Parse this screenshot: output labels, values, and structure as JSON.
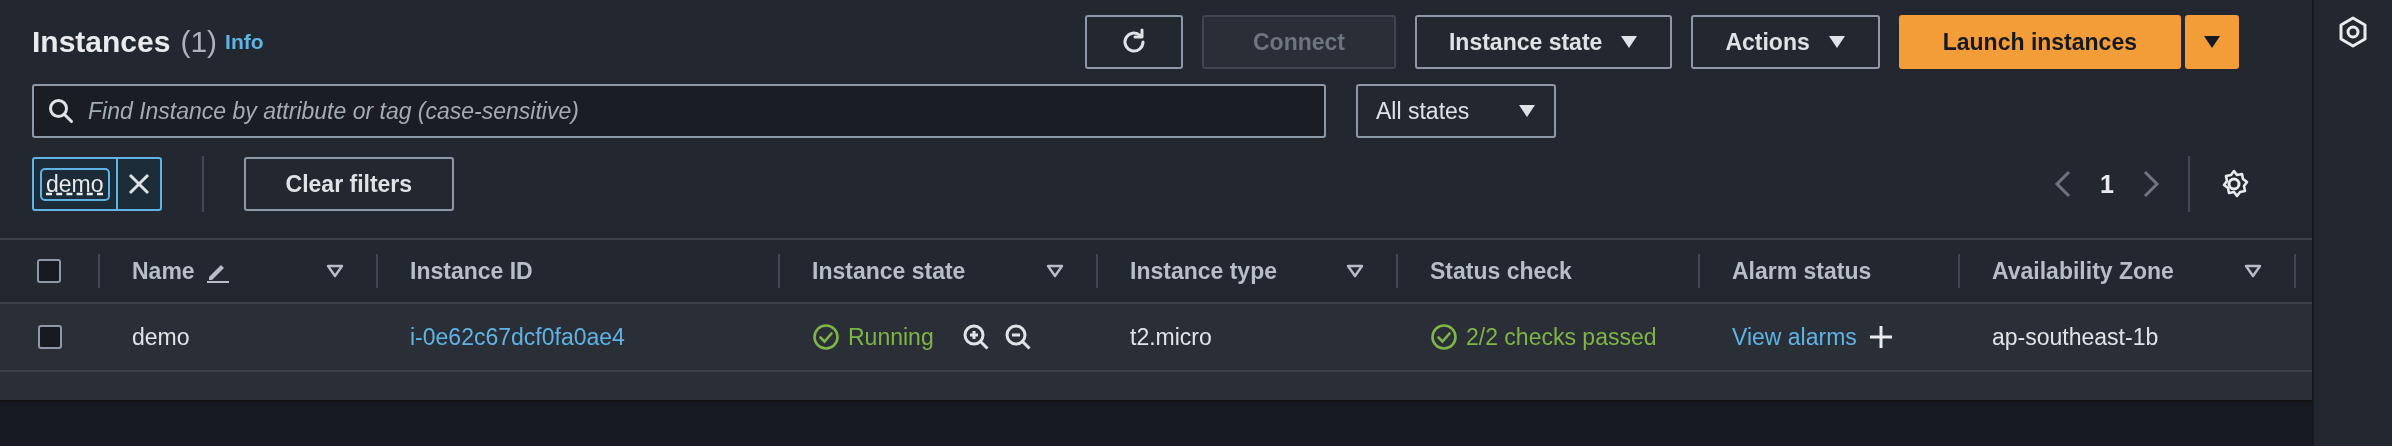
{
  "header": {
    "title": "Instances",
    "count": "(1)",
    "info_link": "Info"
  },
  "toolbar": {
    "buttons": [
      {
        "kind": "refresh",
        "disabled": false
      },
      {
        "kind": "plain",
        "label": "Connect",
        "disabled": true
      },
      {
        "kind": "dropdown",
        "label": "Instance state",
        "disabled": false
      },
      {
        "kind": "dropdown",
        "label": "Actions",
        "disabled": false
      },
      {
        "kind": "primary-split",
        "label": "Launch instances",
        "disabled": false
      }
    ]
  },
  "search": {
    "placeholder": "Find Instance by attribute or tag (case-sensitive)"
  },
  "state_filter": {
    "value": "All states"
  },
  "filter_tokens": [
    {
      "label": "demo"
    }
  ],
  "clear_filters": "Clear filters",
  "pagination": {
    "prev_disabled": true,
    "next_disabled": true,
    "pages": [
      {
        "label": "1",
        "selected": true
      }
    ]
  },
  "table": {
    "select_all_checked": false,
    "columns": [
      {
        "label": "Name",
        "editable": true,
        "filterable": true
      },
      {
        "label": "Instance ID",
        "editable": false,
        "filterable": false
      },
      {
        "label": "Instance state",
        "editable": false,
        "filterable": true
      },
      {
        "label": "Instance type",
        "editable": false,
        "filterable": true
      },
      {
        "label": "Status check",
        "editable": false,
        "filterable": false
      },
      {
        "label": "Alarm status",
        "editable": false,
        "filterable": false
      },
      {
        "label": "Availability Zone",
        "editable": false,
        "filterable": true
      }
    ],
    "rows": [
      {
        "checked": false,
        "cells": [
          {
            "kind": "text",
            "text": "demo"
          },
          {
            "kind": "link",
            "text": "i-0e62c67dcf0fa0ae4"
          },
          {
            "kind": "state",
            "text": "Running"
          },
          {
            "kind": "text",
            "text": "t2.micro"
          },
          {
            "kind": "status",
            "text": "2/2 checks passed"
          },
          {
            "kind": "alarm",
            "text": "View alarms"
          },
          {
            "kind": "text",
            "text": "ap-southeast-1b"
          }
        ]
      }
    ]
  }
}
